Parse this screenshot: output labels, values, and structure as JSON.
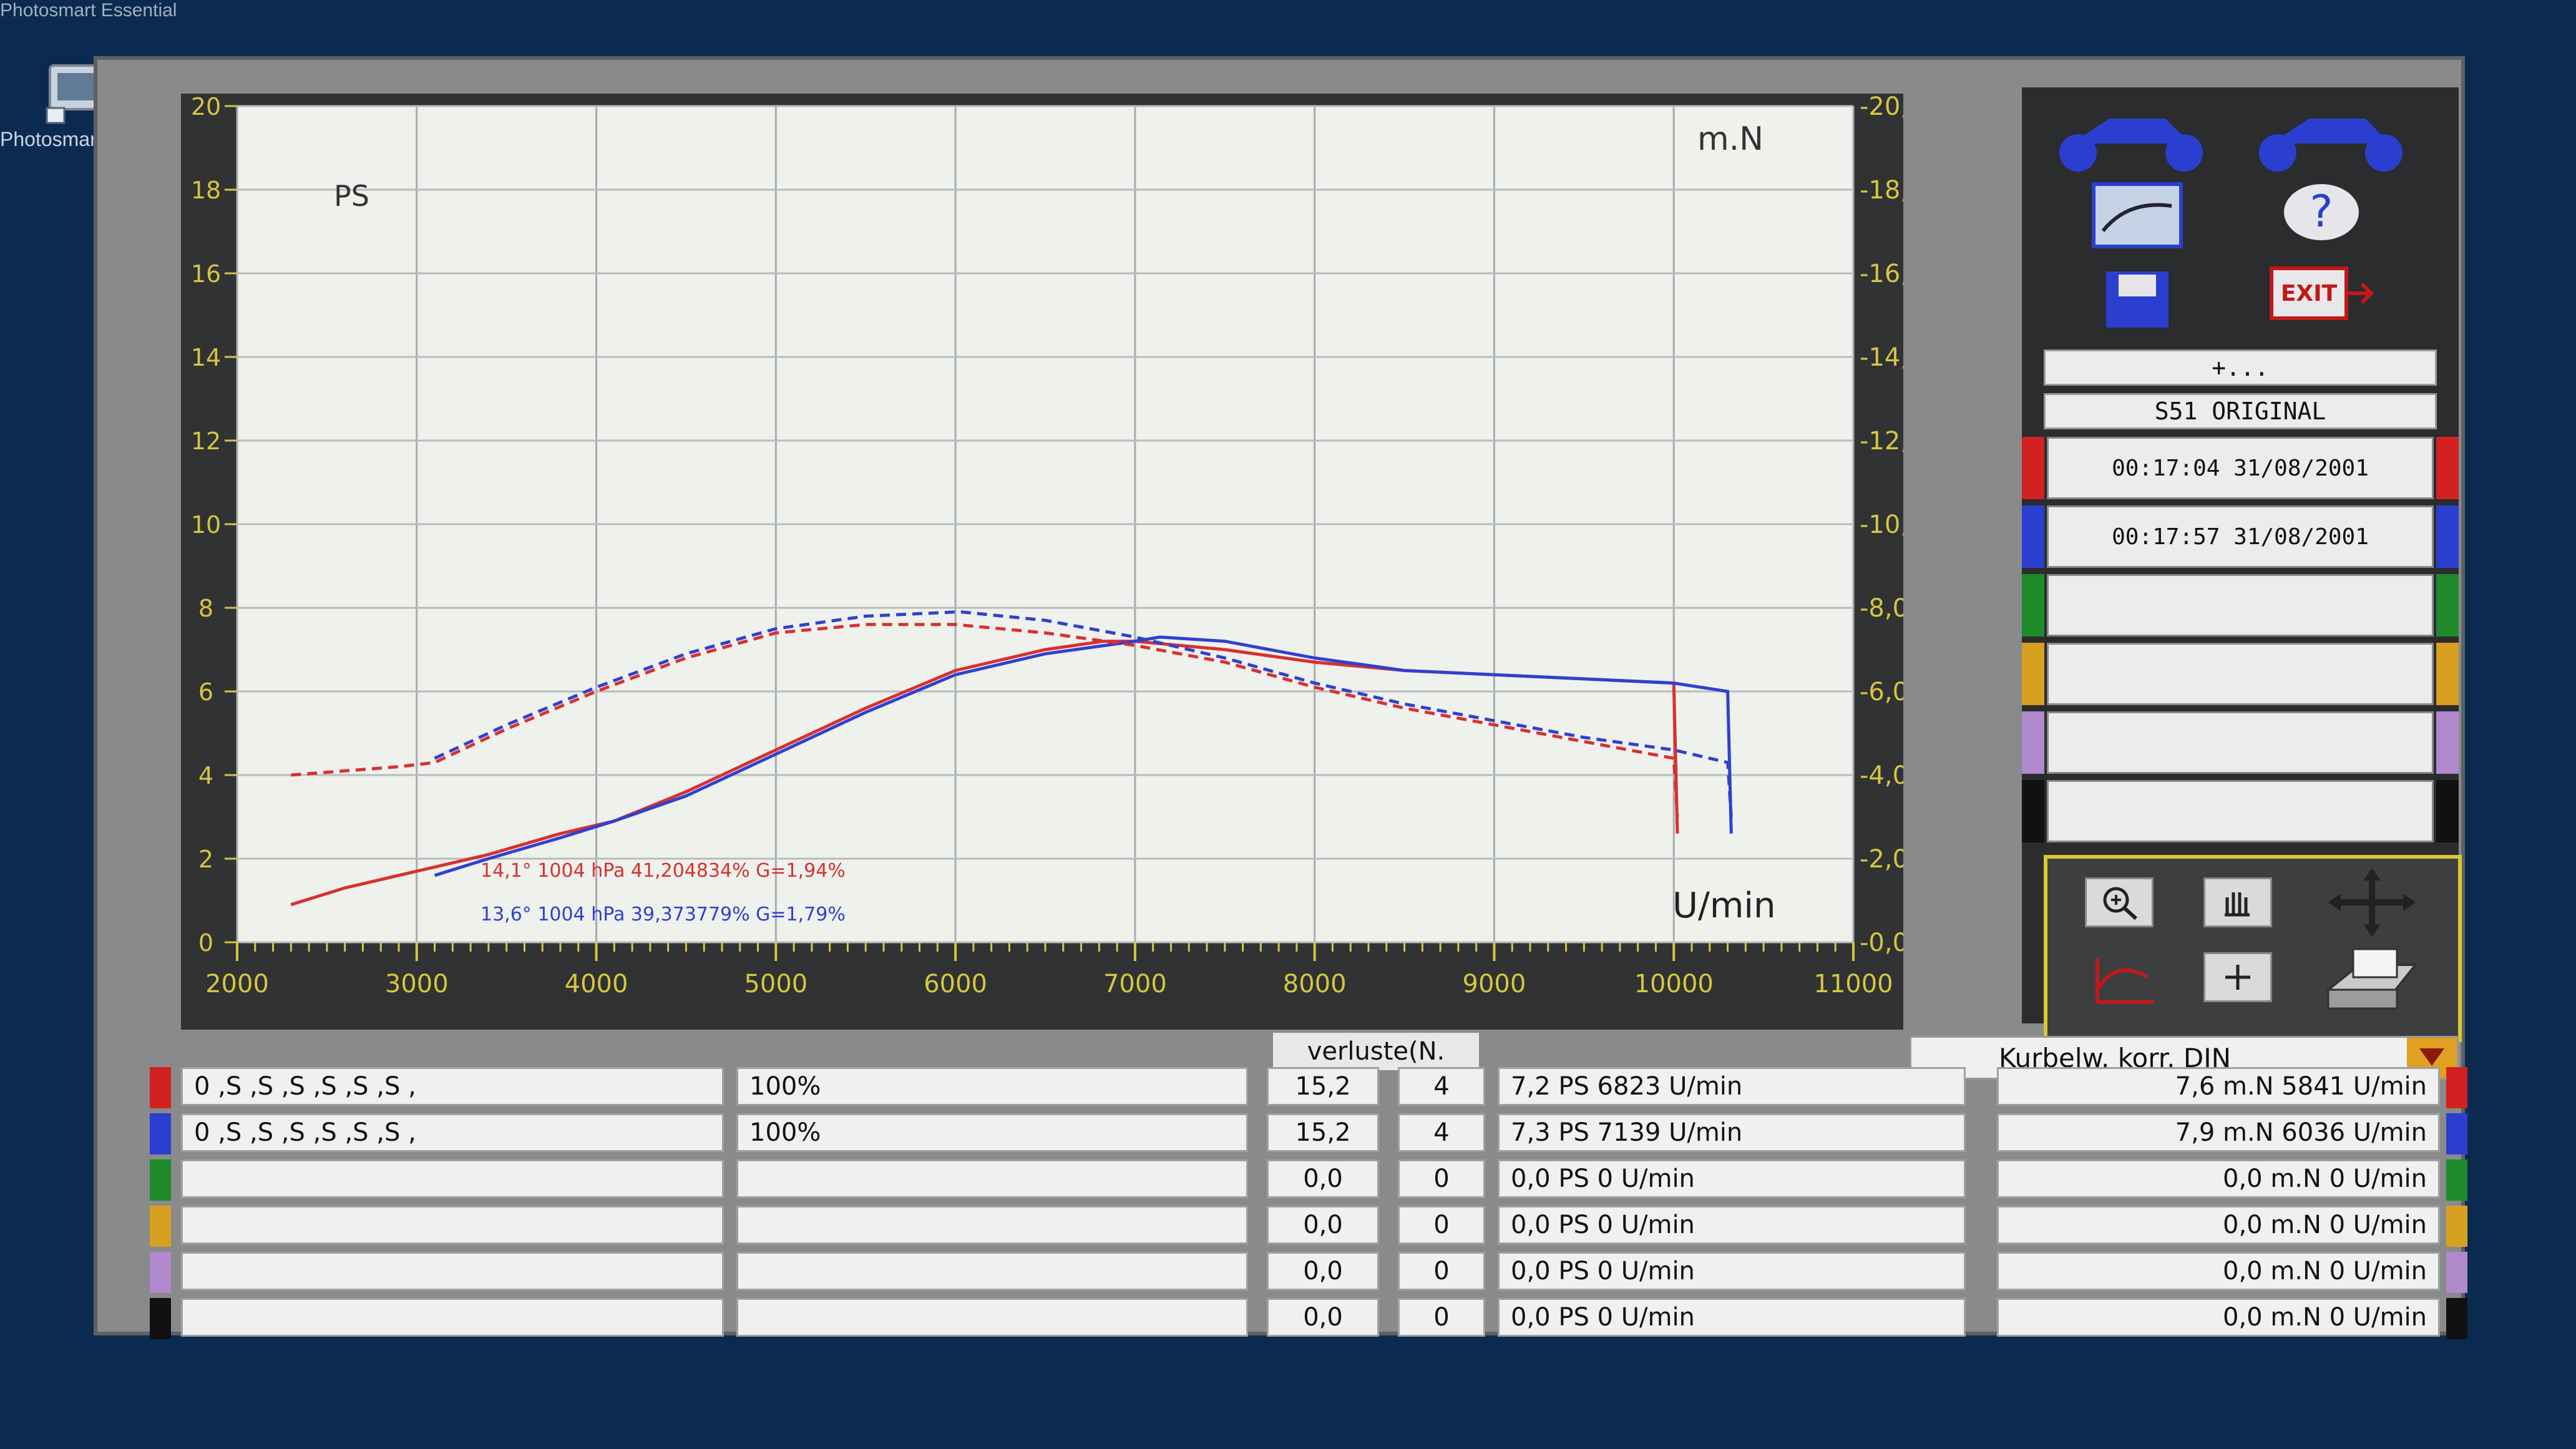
{
  "desktop": {
    "icon_label": "Photosmart Essential",
    "top_label": "Photosmart Essential"
  },
  "chart": {
    "left_unit": "PS",
    "right_unit": "m.N",
    "x_unit": "U/min",
    "annotation_red": "14,1° 1004 hPa  41,204834%    G=1,94%",
    "annotation_blue": "13,6° 1004 hPa  39,373779%    G=1,79%"
  },
  "side": {
    "plus_label": "+...",
    "file_label": "S51 ORIGINAL",
    "slots": [
      {
        "text": "00:17:04  31/08/2001",
        "color": "#d32020"
      },
      {
        "text": "00:17:57  31/08/2001",
        "color": "#2a3fd0"
      },
      {
        "text": "",
        "color": "#1e8a2a"
      },
      {
        "text": "",
        "color": "#d8a020"
      },
      {
        "text": "",
        "color": "#b08acc"
      },
      {
        "text": "",
        "color": "#111111"
      }
    ]
  },
  "table": {
    "verluste_header": "verluste(N.",
    "dropdown_value": "Kurbelw. korr. DIN",
    "rows": [
      {
        "color": "#d32020",
        "name": "0 ,S ,S ,S ,S ,S ,S ,",
        "pct": "100%",
        "verluste": "15,2",
        "n": "4",
        "ps": "7,2 PS 6823 U/min",
        "mn": "7,6 m.N 5841 U/min"
      },
      {
        "color": "#2a3fd0",
        "name": "0  ,S  ,S  ,S  ,S  ,S  ,S  ,",
        "pct": "100%",
        "verluste": "15,2",
        "n": "4",
        "ps": "7,3 PS 7139 U/min",
        "mn": "7,9 m.N 6036 U/min"
      },
      {
        "color": "#1e8a2a",
        "name": "",
        "pct": "",
        "verluste": "0,0",
        "n": "0",
        "ps": "0,0 PS 0 U/min",
        "mn": "0,0 m.N 0 U/min"
      },
      {
        "color": "#d8a020",
        "name": "",
        "pct": "",
        "verluste": "0,0",
        "n": "0",
        "ps": "0,0 PS 0 U/min",
        "mn": "0,0 m.N 0 U/min"
      },
      {
        "color": "#b08acc",
        "name": "",
        "pct": "",
        "verluste": "0,0",
        "n": "0",
        "ps": "0,0 PS 0 U/min",
        "mn": "0,0 m.N 0 U/min"
      },
      {
        "color": "#111111",
        "name": "",
        "pct": "",
        "verluste": "0,0",
        "n": "0",
        "ps": "0,0 PS 0 U/min",
        "mn": "0,0 m.N 0 U/min"
      }
    ]
  },
  "icons": {
    "moto_red": "motorcycle-red-icon",
    "moto_blue": "motorcycle-blue-icon",
    "graph": "graph-settings-icon",
    "help": "help-icon",
    "save": "save-icon",
    "exit": "exit-icon",
    "zoom": "zoom-icon",
    "hand": "pan-hand-icon",
    "move": "move-arrows-icon",
    "curve": "curve-icon",
    "crosshair": "crosshair-icon",
    "print": "printer-icon"
  },
  "chart_data": {
    "type": "line",
    "xlabel": "U/min",
    "ylabel_left": "PS",
    "ylabel_right": "m.N",
    "xlim": [
      2000,
      11000
    ],
    "ylim_left": [
      0,
      20
    ],
    "ylim_right": [
      0,
      20
    ],
    "x_ticks": [
      "2000",
      "3000",
      "4000",
      "5000",
      "6000",
      "7000",
      "8000",
      "9000",
      "10000",
      "11000"
    ],
    "left_ticks": [
      "0",
      "2",
      "4",
      "6",
      "8",
      "10",
      "12",
      "14",
      "16",
      "18",
      "20"
    ],
    "right_ticks": [
      "0,0",
      "2,0",
      "4,0",
      "6,0",
      "8,0",
      "10,0",
      "12,0",
      "14,0",
      "16,0",
      "18,0",
      "20,0"
    ],
    "grid": true,
    "series": [
      {
        "color": "#d83030",
        "style": "solid",
        "x": [
          2300,
          2600,
          2900,
          3100,
          3400,
          3800,
          4100,
          4500,
          5000,
          5500,
          6000,
          6500,
          6823,
          7000,
          7500,
          8000,
          8500,
          9000,
          9500,
          10000,
          10020
        ],
        "y": [
          0.9,
          1.3,
          1.6,
          1.8,
          2.1,
          2.6,
          2.9,
          3.6,
          4.6,
          5.6,
          6.5,
          7.0,
          7.2,
          7.2,
          7.0,
          6.7,
          6.5,
          6.4,
          6.3,
          6.2,
          2.6
        ]
      },
      {
        "color": "#3040d0",
        "style": "solid",
        "x": [
          3100,
          3400,
          3800,
          4100,
          4500,
          5000,
          5500,
          6000,
          6500,
          7000,
          7139,
          7500,
          8000,
          8500,
          9000,
          9500,
          10000,
          10300,
          10320
        ],
        "y": [
          1.6,
          2.0,
          2.5,
          2.9,
          3.5,
          4.5,
          5.5,
          6.4,
          6.9,
          7.2,
          7.3,
          7.2,
          6.8,
          6.5,
          6.4,
          6.3,
          6.2,
          6.0,
          2.6
        ]
      },
      {
        "color": "#d83030",
        "style": "dashed",
        "x": [
          2300,
          2600,
          2900,
          3100,
          3500,
          4000,
          4500,
          5000,
          5500,
          5841,
          6000,
          6500,
          7000,
          7500,
          8000,
          8500,
          9000,
          9500,
          10000,
          10020
        ],
        "y": [
          4.0,
          4.1,
          4.2,
          4.3,
          5.1,
          6.0,
          6.8,
          7.4,
          7.6,
          7.6,
          7.6,
          7.4,
          7.1,
          6.7,
          6.1,
          5.6,
          5.2,
          4.8,
          4.4,
          3.0
        ]
      },
      {
        "color": "#3040d0",
        "style": "dashed",
        "x": [
          3100,
          3500,
          4000,
          4500,
          5000,
          5500,
          6000,
          6036,
          6500,
          7000,
          7500,
          8000,
          8500,
          9000,
          9500,
          10000,
          10300,
          10320
        ],
        "y": [
          4.4,
          5.2,
          6.1,
          6.9,
          7.5,
          7.8,
          7.9,
          7.9,
          7.7,
          7.3,
          6.8,
          6.2,
          5.7,
          5.3,
          4.9,
          4.6,
          4.3,
          3.0
        ]
      }
    ]
  }
}
